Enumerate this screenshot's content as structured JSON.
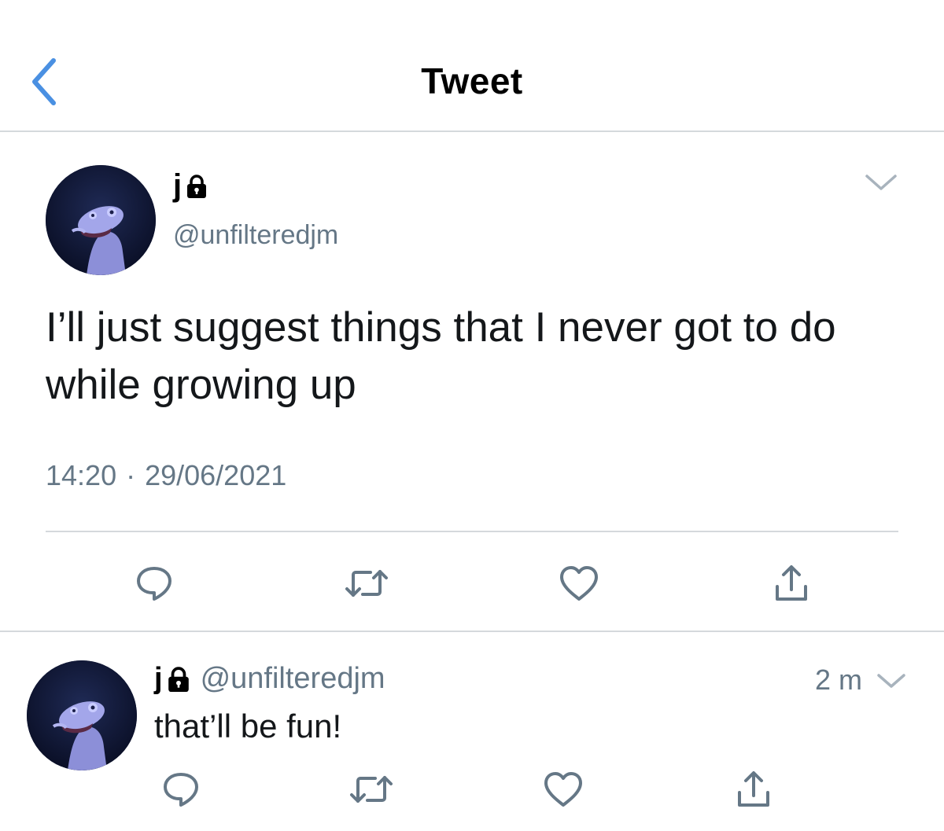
{
  "nav": {
    "title": "Tweet",
    "back_icon": "chevron-left-icon"
  },
  "tweet": {
    "author_name": "j",
    "author_handle": "@unfilteredjm",
    "text": "I’ll just suggest things that I never got to do while growing up",
    "time": "14:20",
    "separator": "·",
    "date": "29/06/2021",
    "actions": [
      "reply-icon",
      "retweet-icon",
      "like-icon",
      "share-icon"
    ]
  },
  "reply": {
    "author_name": "j",
    "author_handle": "@unfilteredjm",
    "time_ago": "2 m",
    "text": "that’ll be fun!",
    "actions": [
      "reply-icon",
      "retweet-icon",
      "like-icon",
      "share-icon"
    ]
  },
  "colors": {
    "accent": "#1da1f2",
    "secondary_text": "#657786",
    "icon": "#657786",
    "divider": "#d5d9dc"
  }
}
